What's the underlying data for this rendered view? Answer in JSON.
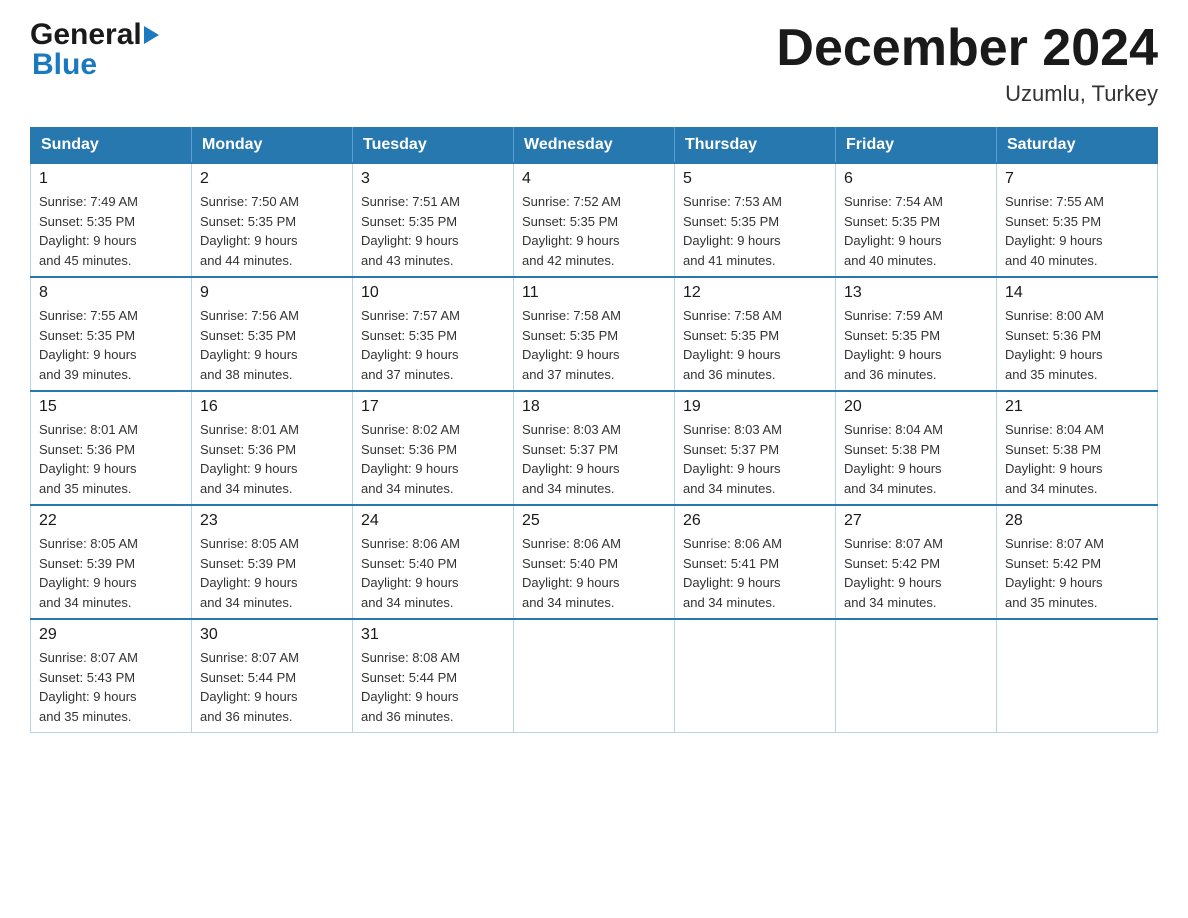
{
  "header": {
    "logo_general": "General",
    "logo_blue": "Blue",
    "month_title": "December 2024",
    "location": "Uzumlu, Turkey"
  },
  "days_of_week": [
    "Sunday",
    "Monday",
    "Tuesday",
    "Wednesday",
    "Thursday",
    "Friday",
    "Saturday"
  ],
  "weeks": [
    {
      "days": [
        {
          "number": "1",
          "sunrise": "7:49 AM",
          "sunset": "5:35 PM",
          "daylight": "9 hours and 45 minutes."
        },
        {
          "number": "2",
          "sunrise": "7:50 AM",
          "sunset": "5:35 PM",
          "daylight": "9 hours and 44 minutes."
        },
        {
          "number": "3",
          "sunrise": "7:51 AM",
          "sunset": "5:35 PM",
          "daylight": "9 hours and 43 minutes."
        },
        {
          "number": "4",
          "sunrise": "7:52 AM",
          "sunset": "5:35 PM",
          "daylight": "9 hours and 42 minutes."
        },
        {
          "number": "5",
          "sunrise": "7:53 AM",
          "sunset": "5:35 PM",
          "daylight": "9 hours and 41 minutes."
        },
        {
          "number": "6",
          "sunrise": "7:54 AM",
          "sunset": "5:35 PM",
          "daylight": "9 hours and 40 minutes."
        },
        {
          "number": "7",
          "sunrise": "7:55 AM",
          "sunset": "5:35 PM",
          "daylight": "9 hours and 40 minutes."
        }
      ]
    },
    {
      "days": [
        {
          "number": "8",
          "sunrise": "7:55 AM",
          "sunset": "5:35 PM",
          "daylight": "9 hours and 39 minutes."
        },
        {
          "number": "9",
          "sunrise": "7:56 AM",
          "sunset": "5:35 PM",
          "daylight": "9 hours and 38 minutes."
        },
        {
          "number": "10",
          "sunrise": "7:57 AM",
          "sunset": "5:35 PM",
          "daylight": "9 hours and 37 minutes."
        },
        {
          "number": "11",
          "sunrise": "7:58 AM",
          "sunset": "5:35 PM",
          "daylight": "9 hours and 37 minutes."
        },
        {
          "number": "12",
          "sunrise": "7:58 AM",
          "sunset": "5:35 PM",
          "daylight": "9 hours and 36 minutes."
        },
        {
          "number": "13",
          "sunrise": "7:59 AM",
          "sunset": "5:35 PM",
          "daylight": "9 hours and 36 minutes."
        },
        {
          "number": "14",
          "sunrise": "8:00 AM",
          "sunset": "5:36 PM",
          "daylight": "9 hours and 35 minutes."
        }
      ]
    },
    {
      "days": [
        {
          "number": "15",
          "sunrise": "8:01 AM",
          "sunset": "5:36 PM",
          "daylight": "9 hours and 35 minutes."
        },
        {
          "number": "16",
          "sunrise": "8:01 AM",
          "sunset": "5:36 PM",
          "daylight": "9 hours and 34 minutes."
        },
        {
          "number": "17",
          "sunrise": "8:02 AM",
          "sunset": "5:36 PM",
          "daylight": "9 hours and 34 minutes."
        },
        {
          "number": "18",
          "sunrise": "8:03 AM",
          "sunset": "5:37 PM",
          "daylight": "9 hours and 34 minutes."
        },
        {
          "number": "19",
          "sunrise": "8:03 AM",
          "sunset": "5:37 PM",
          "daylight": "9 hours and 34 minutes."
        },
        {
          "number": "20",
          "sunrise": "8:04 AM",
          "sunset": "5:38 PM",
          "daylight": "9 hours and 34 minutes."
        },
        {
          "number": "21",
          "sunrise": "8:04 AM",
          "sunset": "5:38 PM",
          "daylight": "9 hours and 34 minutes."
        }
      ]
    },
    {
      "days": [
        {
          "number": "22",
          "sunrise": "8:05 AM",
          "sunset": "5:39 PM",
          "daylight": "9 hours and 34 minutes."
        },
        {
          "number": "23",
          "sunrise": "8:05 AM",
          "sunset": "5:39 PM",
          "daylight": "9 hours and 34 minutes."
        },
        {
          "number": "24",
          "sunrise": "8:06 AM",
          "sunset": "5:40 PM",
          "daylight": "9 hours and 34 minutes."
        },
        {
          "number": "25",
          "sunrise": "8:06 AM",
          "sunset": "5:40 PM",
          "daylight": "9 hours and 34 minutes."
        },
        {
          "number": "26",
          "sunrise": "8:06 AM",
          "sunset": "5:41 PM",
          "daylight": "9 hours and 34 minutes."
        },
        {
          "number": "27",
          "sunrise": "8:07 AM",
          "sunset": "5:42 PM",
          "daylight": "9 hours and 34 minutes."
        },
        {
          "number": "28",
          "sunrise": "8:07 AM",
          "sunset": "5:42 PM",
          "daylight": "9 hours and 35 minutes."
        }
      ]
    },
    {
      "days": [
        {
          "number": "29",
          "sunrise": "8:07 AM",
          "sunset": "5:43 PM",
          "daylight": "9 hours and 35 minutes."
        },
        {
          "number": "30",
          "sunrise": "8:07 AM",
          "sunset": "5:44 PM",
          "daylight": "9 hours and 36 minutes."
        },
        {
          "number": "31",
          "sunrise": "8:08 AM",
          "sunset": "5:44 PM",
          "daylight": "9 hours and 36 minutes."
        },
        null,
        null,
        null,
        null
      ]
    }
  ],
  "labels": {
    "sunrise": "Sunrise:",
    "sunset": "Sunset:",
    "daylight": "Daylight:"
  }
}
